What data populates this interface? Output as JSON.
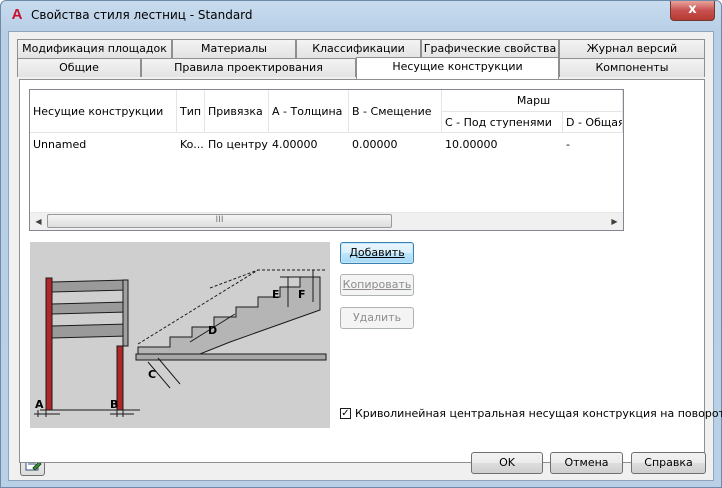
{
  "window": {
    "title": "Свойства стиля лестниц - Standard",
    "app_icon": "A",
    "close_glyph": "x"
  },
  "tabs_row_top": [
    "Модификация площадок",
    "Материалы",
    "Классификации",
    "Графические свойства",
    "Журнал версий"
  ],
  "tabs_row_bottom": [
    "Общие",
    "Правила проектирования",
    "Несущие конструкции",
    "Компоненты"
  ],
  "active_tab": "Несущие конструкции",
  "grid": {
    "group_header": "Марш",
    "columns": [
      "Несущие конструкции",
      "Тип",
      "Привязка",
      "A - Толщина",
      "B - Смещение",
      "C - Под ступенями",
      "D - Общая"
    ],
    "rows": [
      [
        "Unnamed",
        "Ko...",
        "По центру",
        "4.00000",
        "0.00000",
        "10.00000",
        "-"
      ]
    ],
    "scroll_thumb_grip": "III"
  },
  "diagram_labels": {
    "a": "A",
    "b": "B",
    "c": "C",
    "d": "D",
    "e": "E",
    "f": "F"
  },
  "buttons": {
    "add": "Добавить",
    "copy": "Копировать",
    "delete": "Удалить",
    "ok": "OK",
    "cancel": "Отмена",
    "help": "Справка"
  },
  "checkbox": {
    "label": "Криволинейная центральная несущая конструкция на поворотах",
    "checked": true
  },
  "icons": {
    "help_icon": "edit-style-icon"
  },
  "colors": {
    "title_bg": "#b9d0e7",
    "close_button": "#c75050",
    "default_button_border": "#3c7fb1",
    "stringer_red": "#b0272a"
  }
}
